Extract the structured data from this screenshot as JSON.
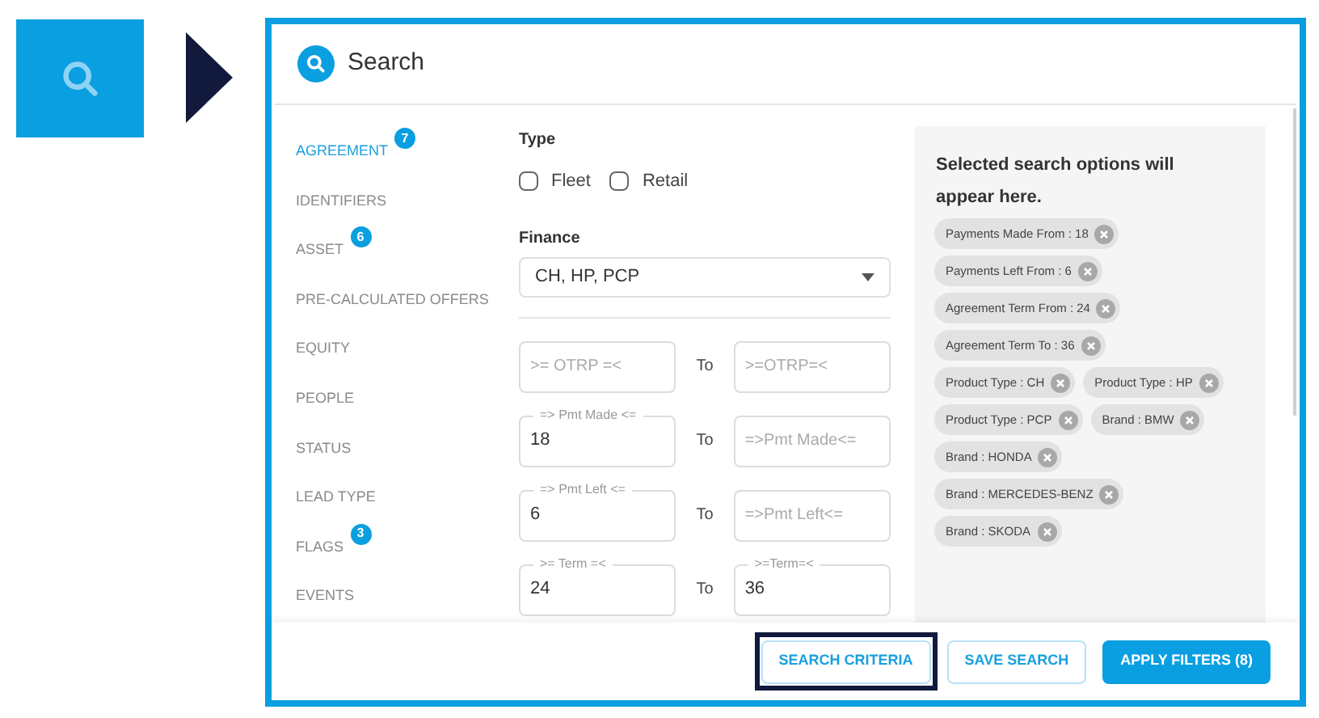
{
  "dialog": {
    "title": "Search"
  },
  "sidebar": {
    "items": [
      {
        "label": "AGREEMENT",
        "selected": true,
        "badge": "7"
      },
      {
        "label": "IDENTIFIERS",
        "selected": false
      },
      {
        "label": "ASSET",
        "selected": false,
        "badge": "6"
      },
      {
        "label": "PRE-CALCULATED OFFERS",
        "selected": false
      },
      {
        "label": "EQUITY",
        "selected": false
      },
      {
        "label": "PEOPLE",
        "selected": false
      },
      {
        "label": "STATUS",
        "selected": false
      },
      {
        "label": "LEAD TYPE",
        "selected": false
      },
      {
        "label": "FLAGS",
        "selected": false,
        "badge": "3"
      },
      {
        "label": "EVENTS",
        "selected": false
      }
    ]
  },
  "type": {
    "label": "Type",
    "options": [
      {
        "label": "Fleet",
        "checked": false
      },
      {
        "label": "Retail",
        "checked": false
      }
    ]
  },
  "finance": {
    "label": "Finance",
    "value": "CH, HP, PCP"
  },
  "ranges": [
    {
      "from": {
        "placeholder": ">= OTRP =<"
      },
      "separator": "To",
      "to": {
        "placeholder": ">=OTRP=<"
      }
    },
    {
      "from": {
        "label": "=> Pmt Made <=",
        "value": "18"
      },
      "separator": "To",
      "to": {
        "placeholder": "=>Pmt Made<="
      }
    },
    {
      "from": {
        "label": "=> Pmt Left <=",
        "value": "6"
      },
      "separator": "To",
      "to": {
        "placeholder": "=>Pmt Left<="
      }
    },
    {
      "from": {
        "label": ">= Term =<",
        "value": "24"
      },
      "separator": "To",
      "to": {
        "label": ">=Term=<",
        "value": "36"
      }
    }
  ],
  "selected_panel": {
    "heading": "Selected search options will appear here.",
    "chips": [
      "Payments Made From : 18",
      "Payments Left From : 6",
      "Agreement Term From : 24",
      "Agreement Term To : 36",
      "Product Type : CH",
      "Product Type : HP",
      "Product Type : PCP",
      "Brand : BMW",
      "Brand : HONDA",
      "Brand : MERCEDES-BENZ",
      "Brand : SKODA"
    ]
  },
  "footer": {
    "buttons": [
      {
        "label": "SEARCH CRITERIA",
        "kind": "outline",
        "highlighted": true
      },
      {
        "label": "SAVE SEARCH",
        "kind": "outline",
        "highlighted": false
      },
      {
        "label": "APPLY FILTERS (8)",
        "kind": "primary",
        "highlighted": false
      }
    ]
  }
}
